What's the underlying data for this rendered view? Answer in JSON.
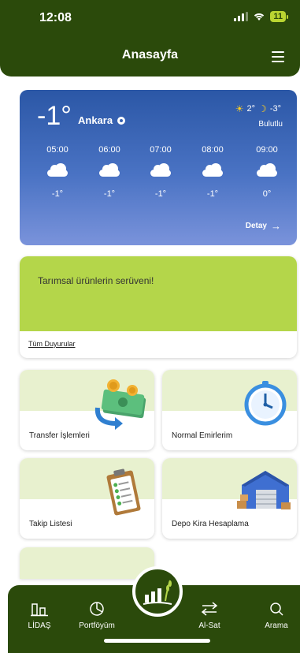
{
  "status_bar": {
    "time": "12:08",
    "battery": "11"
  },
  "header": {
    "title": "Anasayfa"
  },
  "weather": {
    "current_temp": "-1°",
    "city": "Ankara",
    "max_temp": "2°",
    "min_temp": "-3°",
    "condition": "Bulutlu",
    "hourly": [
      {
        "time": "05:00",
        "icon": "cloud-icon",
        "temp": "-1°"
      },
      {
        "time": "06:00",
        "icon": "cloud-icon",
        "temp": "-1°"
      },
      {
        "time": "07:00",
        "icon": "cloud-icon",
        "temp": "-1°"
      },
      {
        "time": "08:00",
        "icon": "cloud-icon",
        "temp": "-1°"
      },
      {
        "time": "09:00",
        "icon": "cloud-icon",
        "temp": "0°"
      }
    ],
    "detail_label": "Detay"
  },
  "announcement": {
    "text": "Tarımsal ürünlerin serüveni!",
    "all_link": "Tüm Duyurular"
  },
  "tiles": [
    {
      "label": "Transfer İşlemleri",
      "icon": "money-transfer-icon"
    },
    {
      "label": "Normal Emirlerim",
      "icon": "stopwatch-icon"
    },
    {
      "label": "Takip Listesi",
      "icon": "clipboard-checklist-icon"
    },
    {
      "label": "Depo Kira Hesaplama",
      "icon": "warehouse-icon"
    }
  ],
  "bottom_nav": {
    "items": [
      {
        "label": "LİDAŞ",
        "icon": "chart-bars-icon"
      },
      {
        "label": "Portföyüm",
        "icon": "pie-chart-icon"
      },
      {
        "label": "Al-Sat",
        "icon": "exchange-arrows-icon"
      },
      {
        "label": "Arama",
        "icon": "search-icon"
      }
    ],
    "center_icon": "wheat-growth-icon"
  },
  "colors": {
    "primary_green": "#2b4a0b",
    "accent_lime": "#b4d64a",
    "tile_bg": "#e8f1cf",
    "weather_blue": "#2b57a6"
  }
}
